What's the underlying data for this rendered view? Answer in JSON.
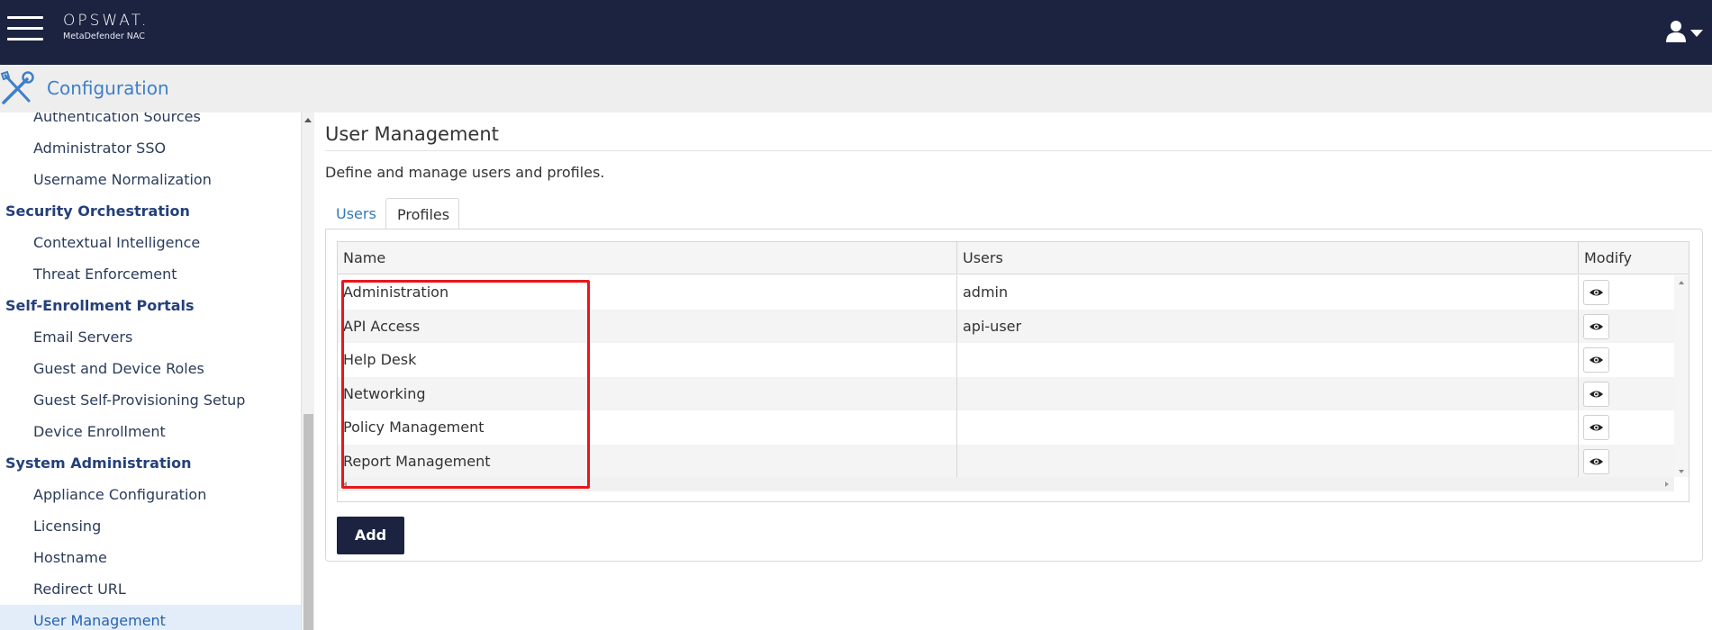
{
  "header": {
    "brand_name": "OPSWAT.",
    "brand_product": "MetaDefender NAC"
  },
  "section": {
    "title": "Configuration"
  },
  "sidebar": {
    "items": [
      {
        "label": "Authentication Sources",
        "type": "sub"
      },
      {
        "label": "Administrator SSO",
        "type": "sub"
      },
      {
        "label": "Username Normalization",
        "type": "sub"
      },
      {
        "label": "Security Orchestration",
        "type": "cat"
      },
      {
        "label": "Contextual Intelligence",
        "type": "sub"
      },
      {
        "label": "Threat Enforcement",
        "type": "sub"
      },
      {
        "label": "Self-Enrollment Portals",
        "type": "cat"
      },
      {
        "label": "Email Servers",
        "type": "sub"
      },
      {
        "label": "Guest and Device Roles",
        "type": "sub"
      },
      {
        "label": "Guest Self-Provisioning Setup",
        "type": "sub"
      },
      {
        "label": "Device Enrollment",
        "type": "sub"
      },
      {
        "label": "System Administration",
        "type": "cat"
      },
      {
        "label": "Appliance Configuration",
        "type": "sub"
      },
      {
        "label": "Licensing",
        "type": "sub"
      },
      {
        "label": "Hostname",
        "type": "sub"
      },
      {
        "label": "Redirect URL",
        "type": "sub"
      },
      {
        "label": "User Management",
        "type": "sub",
        "active": true
      }
    ]
  },
  "main": {
    "title": "User Management",
    "description": "Define and manage users and profiles.",
    "tabs": [
      {
        "label": "Users",
        "active": false
      },
      {
        "label": "Profiles",
        "active": true
      }
    ],
    "table": {
      "columns": [
        "Name",
        "Users",
        "Modify"
      ],
      "rows": [
        {
          "name": "Administration",
          "users": "admin"
        },
        {
          "name": "API Access",
          "users": "api-user"
        },
        {
          "name": "Help Desk",
          "users": ""
        },
        {
          "name": "Networking",
          "users": ""
        },
        {
          "name": "Policy Management",
          "users": ""
        },
        {
          "name": "Report Management",
          "users": ""
        }
      ]
    },
    "add_label": "Add"
  },
  "colors": {
    "header_bg": "#1b2340",
    "accent": "#3f7fc8",
    "highlight": "#e8161b"
  },
  "icons": {
    "menu": "hamburger-icon",
    "user": "user-icon",
    "config": "tools-icon",
    "view": "eye-icon"
  }
}
